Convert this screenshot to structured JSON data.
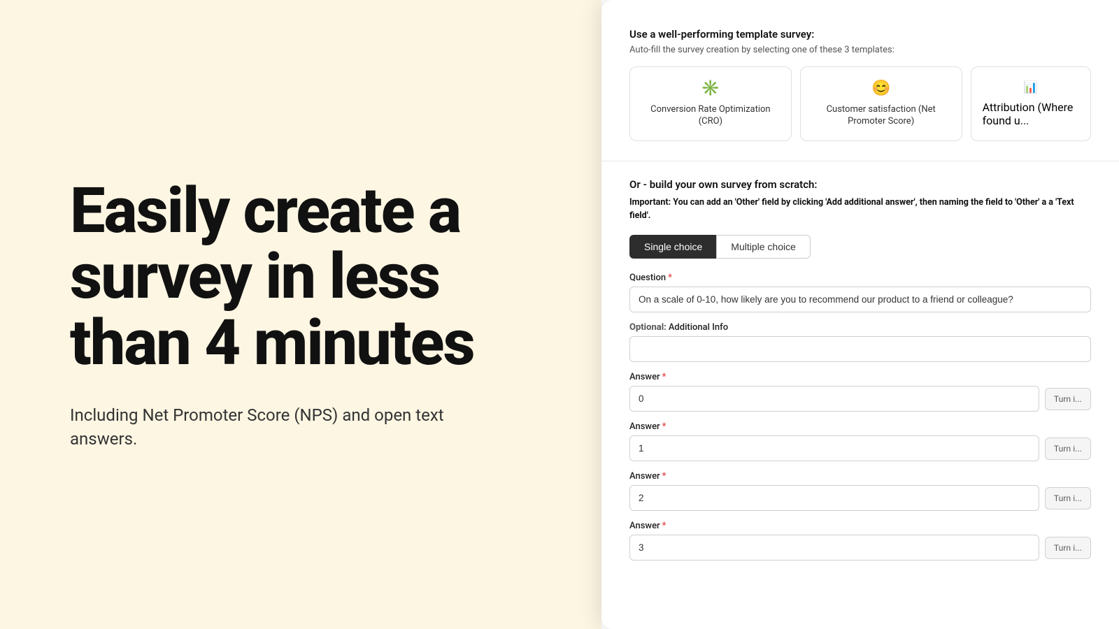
{
  "left": {
    "hero_title": "Easily create a survey in less than 4 minutes",
    "hero_subtitle": "Including Net Promoter Score (NPS) and open text answers."
  },
  "right": {
    "template_section": {
      "title": "Use a well-performing template survey:",
      "desc": "Auto-fill the survey creation by selecting one of these 3 templates:",
      "cards": [
        {
          "icon": "✳️",
          "label": "Conversion Rate Optimization (CRO)"
        },
        {
          "icon": "😊",
          "label": "Customer satisfaction (Net Promoter Score)"
        },
        {
          "icon": "📊",
          "label": "Attribution (Where found u..."
        }
      ]
    },
    "scratch_section": {
      "title": "Or - build your own survey from scratch:",
      "note_bold": "Important:",
      "note_text": "You can add an 'Other' field by clicking 'Add additional answer', then naming the field to 'Other' a a 'Text field'.",
      "toggle": {
        "single_choice": "Single choice",
        "multiple_choice": "Multiple choice",
        "active": "single_choice"
      },
      "question_label": "Question",
      "question_placeholder": "On a scale of 0-10, how likely are you to recommend our product to a friend or colleague?",
      "optional_label": "Optional:",
      "additional_info_label": "Additional Info",
      "additional_info_placeholder": "",
      "answers": [
        {
          "label": "Answer",
          "value": "0",
          "turn_in": "Turn i..."
        },
        {
          "label": "Answer",
          "value": "1",
          "turn_in": "Turn i..."
        },
        {
          "label": "Answer",
          "value": "2",
          "turn_in": "Turn i..."
        },
        {
          "label": "Answer",
          "value": "3",
          "turn_in": "Turn i..."
        }
      ]
    }
  }
}
